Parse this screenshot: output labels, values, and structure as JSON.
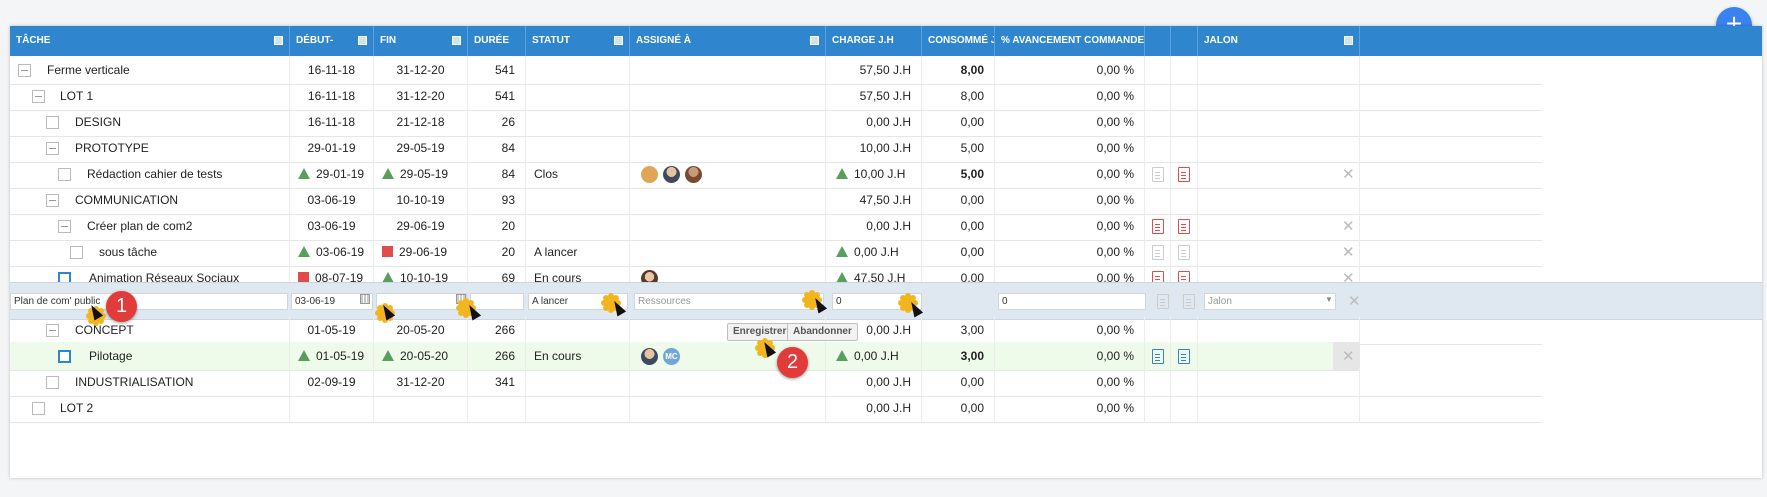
{
  "header": {
    "columns": [
      {
        "key": "tache",
        "label": "TÂCHE"
      },
      {
        "key": "debut",
        "label": "DÉBUT-"
      },
      {
        "key": "fin",
        "label": "FIN"
      },
      {
        "key": "duree",
        "label": "DURÉE"
      },
      {
        "key": "statut",
        "label": "STATUT"
      },
      {
        "key": "assigne",
        "label": "ASSIGNÉ À"
      },
      {
        "key": "charge",
        "label": "CHARGE J.H"
      },
      {
        "key": "consomme",
        "label": "CONSOMMÉ J.H"
      },
      {
        "key": "avancement",
        "label": "% AVANCEMENT COMMANDE"
      },
      {
        "key": "jalon",
        "label": "JALON"
      }
    ]
  },
  "rows": [
    {
      "name": "Ferme verticale",
      "debut": "16-11-18",
      "fin": "31-12-20",
      "duree": "541",
      "statut": "",
      "charge": "57,50 J.H",
      "consomme": "8,00",
      "avancement": "0,00 %"
    },
    {
      "name": "LOT 1",
      "debut": "16-11-18",
      "fin": "31-12-20",
      "duree": "541",
      "statut": "",
      "charge": "57,50 J.H",
      "consomme": "8,00",
      "avancement": "0,00 %"
    },
    {
      "name": "DESIGN",
      "debut": "16-11-18",
      "fin": "21-12-18",
      "duree": "26",
      "statut": "",
      "charge": "0,00 J.H",
      "consomme": "0,00",
      "avancement": "0,00 %"
    },
    {
      "name": "PROTOTYPE",
      "debut": "29-01-19",
      "fin": "29-05-19",
      "duree": "84",
      "statut": "",
      "charge": "10,00 J.H",
      "consomme": "5,00",
      "avancement": "0,00 %"
    },
    {
      "name": "Rédaction cahier de tests",
      "debut": "29-01-19",
      "fin": "29-05-19",
      "duree": "84",
      "statut": "Clos",
      "charge": "10,00 J.H",
      "consomme": "5,00",
      "avancement": "0,00 %"
    },
    {
      "name": "COMMUNICATION",
      "debut": "03-06-19",
      "fin": "10-10-19",
      "duree": "93",
      "statut": "",
      "charge": "47,50 J.H",
      "consomme": "0,00",
      "avancement": "0,00 %"
    },
    {
      "name": "Créer plan de com2",
      "debut": "03-06-19",
      "fin": "29-06-19",
      "duree": "20",
      "statut": "",
      "charge": "0,00 J.H",
      "consomme": "0,00",
      "avancement": "0,00 %"
    },
    {
      "name": "sous tâche",
      "debut": "03-06-19",
      "fin": "29-06-19",
      "duree": "20",
      "statut": "A lancer",
      "charge": "0,00 J.H",
      "consomme": "0,00",
      "avancement": "0,00 %"
    },
    {
      "name": "Animation Réseaux Sociaux",
      "debut": "08-07-19",
      "fin": "10-10-19",
      "duree": "69",
      "statut": "En cours",
      "charge": "47,50 J.H",
      "consomme": "0,00",
      "avancement": "0,00 %"
    },
    {
      "name": "CONCEPT",
      "debut": "01-05-19",
      "fin": "20-05-20",
      "duree": "266",
      "statut": "",
      "charge": "0,00 J.H",
      "consomme": "3,00",
      "avancement": "0,00 %"
    },
    {
      "name": "Pilotage",
      "debut": "01-05-19",
      "fin": "20-05-20",
      "duree": "266",
      "statut": "En cours",
      "charge": "0,00 J.H",
      "consomme": "3,00",
      "avancement": "0,00 %"
    },
    {
      "name": "INDUSTRIALISATION",
      "debut": "02-09-19",
      "fin": "31-12-20",
      "duree": "341",
      "statut": "",
      "charge": "0,00 J.H",
      "consomme": "0,00",
      "avancement": "0,00 %"
    },
    {
      "name": "LOT 2",
      "debut": "",
      "fin": "",
      "duree": "",
      "statut": "",
      "charge": "0,00 J.H",
      "consomme": "0,00",
      "avancement": "0,00 %"
    }
  ],
  "edit_row": {
    "name_value": "Plan de com' public",
    "debut_value": "03-06-19",
    "fin_value": "",
    "statut_value": "A lancer",
    "ressources_placeholder": "Ressources",
    "charge_value": "0",
    "avancement_value": "0",
    "jalon_placeholder": "Jalon",
    "save_label": "Enregistrer",
    "cancel_label": "Abandonner"
  },
  "avatar_initials": "MC",
  "callouts": {
    "one": "1",
    "two": "2"
  },
  "fab_label": "+"
}
